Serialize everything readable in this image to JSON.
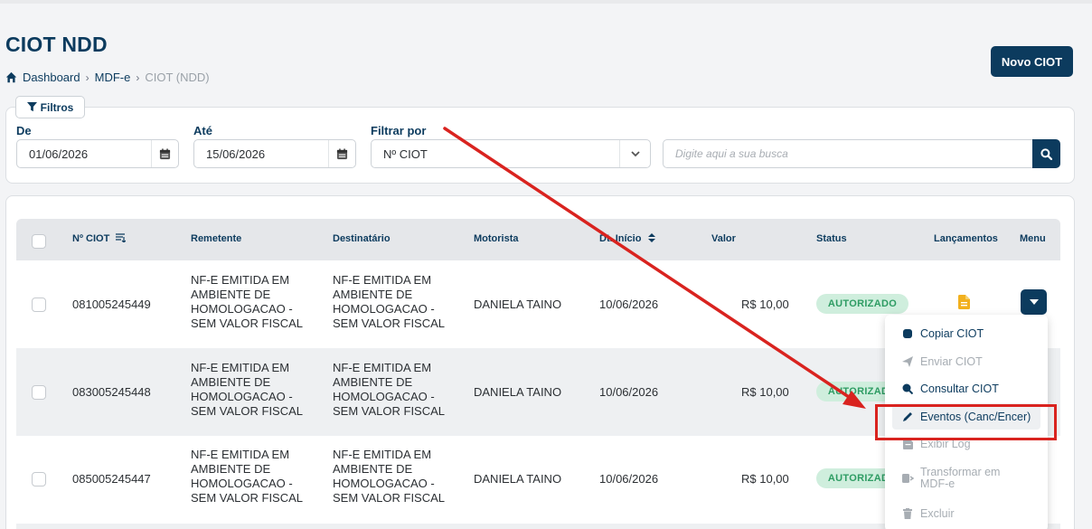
{
  "header": {
    "title": "CIOT NDD",
    "breadcrumb": [
      "Dashboard",
      "MDF-e",
      "CIOT (NDD)"
    ],
    "new_button": "Novo CIOT"
  },
  "filters": {
    "tab_label": "Filtros",
    "from_label": "De",
    "from_value": "01/06/2026",
    "to_label": "Até",
    "to_value": "15/06/2026",
    "filter_by_label": "Filtrar por",
    "filter_by_value": "Nº CIOT",
    "search_placeholder": "Digite aqui a sua busca"
  },
  "table": {
    "columns": [
      "Nº CIOT",
      "Remetente",
      "Destinatário",
      "Motorista",
      "Dt. Início",
      "Valor",
      "Status",
      "Lançamentos",
      "Menu"
    ],
    "rows": [
      {
        "ciot": "081005245449",
        "remetente": [
          "NF-E EMITIDA EM",
          "AMBIENTE DE",
          "HOMOLOGACAO -",
          "SEM VALOR FISCAL"
        ],
        "destinatario": [
          "NF-E EMITIDA EM",
          "AMBIENTE DE",
          "HOMOLOGACAO -",
          "SEM VALOR FISCAL"
        ],
        "motorista": "DANIELA TAINO",
        "inicio": "10/06/2026",
        "valor": "R$ 10,00",
        "status": "AUTORIZADO"
      },
      {
        "ciot": "083005245448",
        "remetente": [
          "NF-E EMITIDA EM",
          "AMBIENTE DE",
          "HOMOLOGACAO -",
          "SEM VALOR FISCAL"
        ],
        "destinatario": [
          "NF-E EMITIDA EM",
          "AMBIENTE DE",
          "HOMOLOGACAO -",
          "SEM VALOR FISCAL"
        ],
        "motorista": "DANIELA TAINO",
        "inicio": "10/06/2026",
        "valor": "R$ 10,00",
        "status": "AUTORIZADO"
      },
      {
        "ciot": "085005245447",
        "remetente": [
          "NF-E EMITIDA EM",
          "AMBIENTE DE",
          "HOMOLOGACAO -",
          "SEM VALOR FISCAL"
        ],
        "destinatario": [
          "NF-E EMITIDA EM",
          "AMBIENTE DE",
          "HOMOLOGACAO -",
          "SEM VALOR FISCAL"
        ],
        "motorista": "DANIELA TAINO",
        "inicio": "10/06/2026",
        "valor": "R$ 10,00",
        "status": "AUTORIZADO"
      }
    ]
  },
  "menu": {
    "items": [
      {
        "label": "Copiar CIOT",
        "icon": "copy-icon",
        "enabled": true
      },
      {
        "label": "Enviar CIOT",
        "icon": "send-icon",
        "enabled": false
      },
      {
        "label": "Consultar CIOT",
        "icon": "search-icon",
        "enabled": true
      },
      {
        "label": "Eventos (Canc/Encer)",
        "icon": "pencil-icon",
        "enabled": true,
        "highlighted": true
      },
      {
        "label": "Exibir Log",
        "icon": "log-icon",
        "enabled": false
      },
      {
        "label": "Transformar em MDF-e",
        "label_lines": [
          "Transformar em",
          "MDF-e"
        ],
        "icon": "transform-icon",
        "enabled": false
      },
      {
        "label": "Excluir",
        "icon": "trash-icon",
        "enabled": false
      }
    ]
  },
  "colors": {
    "primary": "#0c3b5e",
    "status_bg": "#cfeedd",
    "status_text": "#2e9c63",
    "annotation": "#d9231f",
    "document_icon": "#f2b01e"
  }
}
